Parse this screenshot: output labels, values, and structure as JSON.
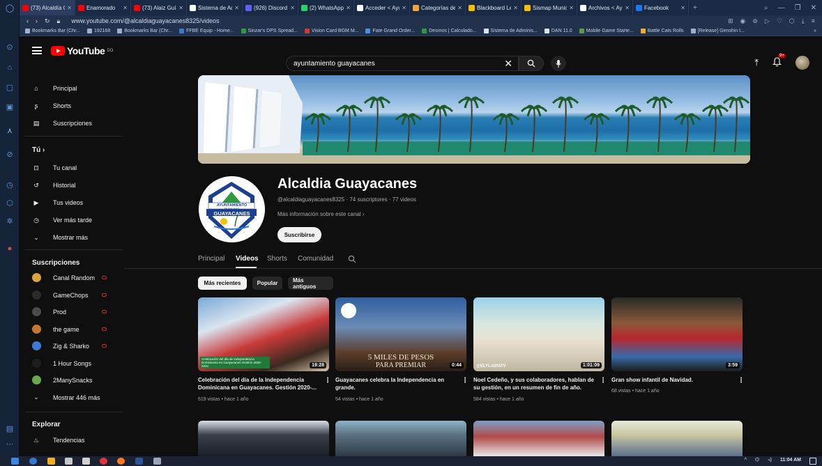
{
  "browser": {
    "tabs": [
      {
        "label": "(73) Alcaldía G",
        "color": "#ff0000",
        "active": true
      },
      {
        "label": "Enamorado",
        "color": "#ff0000"
      },
      {
        "label": "(73) Alaiz Guía",
        "color": "#ff0000"
      },
      {
        "label": "Sistema de Adm",
        "color": "#ffffff"
      },
      {
        "label": "(926) Discord |",
        "color": "#5865f2"
      },
      {
        "label": "(2) WhatsApp",
        "color": "#25d366"
      },
      {
        "label": "Acceder < Ayu",
        "color": "#ffffff"
      },
      {
        "label": "Categorías de",
        "color": "#f2a33a"
      },
      {
        "label": "Blackboard Lea",
        "color": "#f2c200"
      },
      {
        "label": "Sismap Munici",
        "color": "#f2c200"
      },
      {
        "label": "Archivos < Ayu",
        "color": "#ffffff"
      },
      {
        "label": "Facebook",
        "color": "#1877f2"
      }
    ],
    "url": "www.youtube.com/@alcaldiaguayacanes8325/videos",
    "bookmarks": [
      "Bookmarks Bar (Chr...",
      "192168",
      "Bookmarks Bar (Chr...",
      "FFBE Equip - Home...",
      "Sinzar's DPS Spread...",
      "Vision Card BGM M...",
      "Fate Grand Order...",
      "Desmos | Calculado...",
      "Sistema de Adminis...",
      "DAN 11.0",
      "Mobile Game Starte...",
      "Battle Cats Rolls",
      "[Release] Genshin I..."
    ]
  },
  "youtube": {
    "logo_text": "YouTube",
    "logo_region": "DO",
    "search_query": "ayuntamiento guayacanes",
    "notif_count": "9+",
    "sidebar": {
      "main": [
        {
          "label": "Principal",
          "icon": "home-icon"
        },
        {
          "label": "Shorts",
          "icon": "shorts-icon"
        },
        {
          "label": "Suscripciones",
          "icon": "subscriptions-icon"
        }
      ],
      "you_header": "Tú",
      "you": [
        {
          "label": "Tu canal",
          "icon": "channel-icon"
        },
        {
          "label": "Historial",
          "icon": "history-icon"
        },
        {
          "label": "Tus videos",
          "icon": "your-videos-icon"
        },
        {
          "label": "Ver más tarde",
          "icon": "watch-later-icon"
        },
        {
          "label": "Mostrar más",
          "icon": "chevron-down-icon"
        }
      ],
      "subs_header": "Suscripciones",
      "subs": [
        {
          "label": "Canal Random",
          "color": "#d8a53c",
          "live": true
        },
        {
          "label": "GameChops",
          "color": "#2b2b2b",
          "live": true
        },
        {
          "label": "Prod",
          "color": "#4b4b4b",
          "live": true
        },
        {
          "label": "the game",
          "color": "#c6772f",
          "live": true
        },
        {
          "label": "Zig & Sharko",
          "color": "#3d7bd6",
          "live": true
        },
        {
          "label": "1 Hour Songs",
          "color": "#1e1e1e",
          "live": false
        },
        {
          "label": "2ManySnacks",
          "color": "#6aa84f",
          "live": false
        },
        {
          "label": "Mostrar 446 más",
          "color": "",
          "live": false
        }
      ],
      "explore_header": "Explorar",
      "explore": [
        {
          "label": "Tendencias",
          "icon": "trending-icon"
        }
      ]
    },
    "channel": {
      "name": "Alcaldia Guayacanes",
      "handle": "@alcaldiaguayacanes8325",
      "subs": "74 suscriptores",
      "videos": "77 videos",
      "more_info": "Más información sobre este canal",
      "subscribe_label": "Suscribirse",
      "avatar_text_top": "AYUNTAMIENTO",
      "avatar_text_mid": "MUNICIPIO",
      "avatar_text_main": "GUAYACANES"
    },
    "tabs": [
      "Principal",
      "Videos",
      "Shorts",
      "Comunidad"
    ],
    "chips": [
      "Más recientes",
      "Popular",
      "Más antiguos"
    ],
    "videos": [
      {
        "title": "Celebración del día de la Independencia Dominicana en Guayacanes. Gestión 2020-...",
        "meta": "519 vistas • hace 1 año",
        "duration": "19:28",
        "overlay": "Celebración del día de Independencia Dominicana en Guayacanes Gestión 2020-2024"
      },
      {
        "title": "Guayacanes celebra la Independencia en grande.",
        "meta": "54 vistas • hace 1 año",
        "duration": "0:44",
        "overlay_1": "5 MILES DE PESOS",
        "overlay_2": "PARA PREMIAR"
      },
      {
        "title": "Noel Cedeño, y sus colaboradores, hablan de su gestión, en un resumen de fin de año.",
        "meta": "584 vistas • hace 1 año",
        "duration": "1:01:09",
        "overlay": "@ELYLAIRATV"
      },
      {
        "title": "Gran show infantil de Navidad.",
        "meta": "68 vistas • hace 1 año",
        "duration": "3:59"
      }
    ]
  },
  "taskbar": {
    "time": "11:04 AM"
  }
}
